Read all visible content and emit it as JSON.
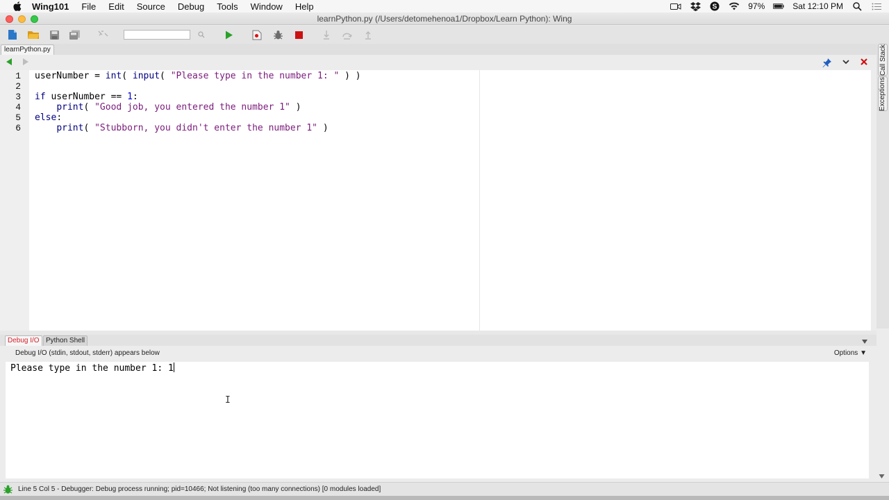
{
  "menubar": {
    "app_name": "Wing101",
    "items": [
      "File",
      "Edit",
      "Source",
      "Debug",
      "Tools",
      "Window",
      "Help"
    ],
    "battery": "97%",
    "clock": "Sat 12:10 PM"
  },
  "window": {
    "title": "learnPython.py (/Users/detomehenoa1/Dropbox/Learn Python): Wing"
  },
  "toolbar": {
    "search_value": ""
  },
  "editor": {
    "tab_label": "learnPython.py",
    "line_numbers": [
      "1",
      "2",
      "3",
      "4",
      "5",
      "6"
    ],
    "lines": [
      "userNumber = int( input( \"Please type in the number 1: \" ) )",
      "",
      "if userNumber == 1:",
      "    print( \"Good job, you entered the number 1\" )",
      "else:",
      "    print( \"Stubborn, you didn't enter the number 1\" )"
    ]
  },
  "side_tabs": {
    "call_stack": "Call Stack",
    "exceptions": "Exceptions"
  },
  "panel": {
    "tabs": [
      "Debug I/O",
      "Python Shell"
    ],
    "description": "Debug I/O (stdin, stdout, stderr) appears below",
    "options_label": "Options",
    "console_output": "Please type in the number 1: 1"
  },
  "statusbar": {
    "text": "Line 5 Col 5 - Debugger: Debug process running; pid=10466; Not listening (too many connections) [0 modules loaded]"
  },
  "colors": {
    "keyword": "#000080",
    "string": "#7b1b7b",
    "number": "#0000cc",
    "active_tab": "#d6232b",
    "run_green": "#2aa12a",
    "stop_red": "#cc1111"
  }
}
